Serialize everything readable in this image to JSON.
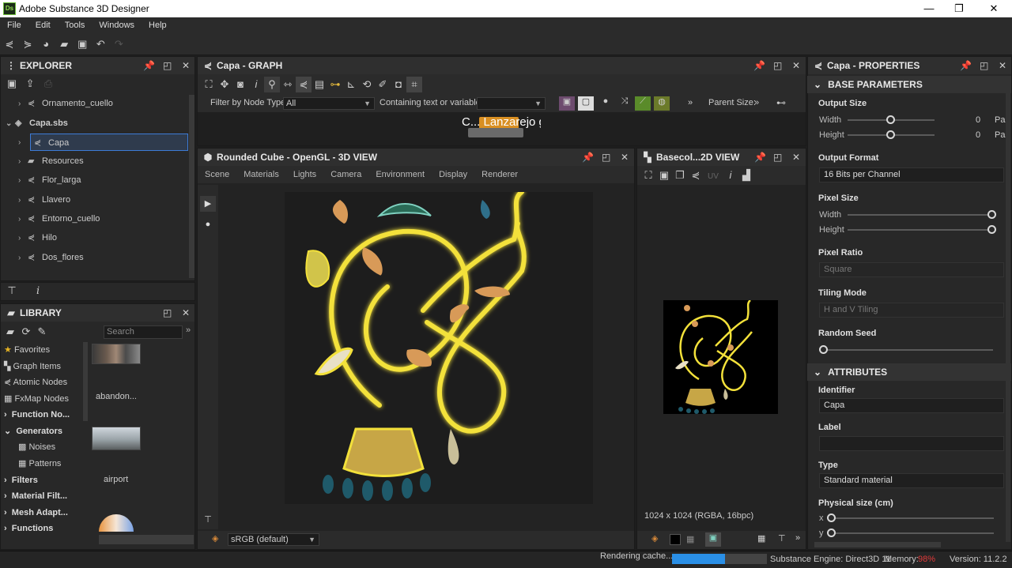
{
  "app": {
    "title": "Adobe Substance 3D Designer",
    "icon_text": "Ds"
  },
  "window_controls": {
    "minimize": "—",
    "maximize": "❐",
    "close": "✕"
  },
  "menu": [
    "File",
    "Edit",
    "Tools",
    "Windows",
    "Help"
  ],
  "explorer": {
    "title": "EXPLORER",
    "items": [
      {
        "label": "Ornamento_cuello",
        "level": 1
      },
      {
        "label": "Capa.sbs",
        "level": 0
      },
      {
        "label": "Capa",
        "level": 1
      },
      {
        "label": "Resources",
        "level": 1
      },
      {
        "label": "Flor_larga",
        "level": 1
      },
      {
        "label": "Llavero",
        "level": 1
      },
      {
        "label": "Entorno_cuello",
        "level": 1
      },
      {
        "label": "Hilo",
        "level": 1
      },
      {
        "label": "Dos_flores",
        "level": 1
      }
    ]
  },
  "library": {
    "title": "LIBRARY",
    "search_placeholder": "Search",
    "categories": [
      {
        "label": "Favorites"
      },
      {
        "label": "Graph Items"
      },
      {
        "label": "Atomic Nodes"
      },
      {
        "label": "FxMap Nodes"
      },
      {
        "label": "Function No..."
      },
      {
        "label": "Generators"
      },
      {
        "label": "Noises"
      },
      {
        "label": "Patterns"
      },
      {
        "label": "Filters"
      },
      {
        "label": "Material Filt..."
      },
      {
        "label": "Mesh Adapt..."
      },
      {
        "label": "Functions"
      }
    ],
    "thumbnails": [
      "abandon...",
      "airport"
    ]
  },
  "graph": {
    "title": "Capa - GRAPH",
    "filter_label": "Filter by Node Type",
    "filter_value": "All",
    "containing_label": "Containing text or variable",
    "parent_size_label": "Parent Size:",
    "overlay_text": "C... Lanzarejo grande"
  },
  "view3d": {
    "title": "Rounded Cube - OpenGL - 3D VIEW",
    "tabs": [
      "Scene",
      "Materials",
      "Lights",
      "Camera",
      "Environment",
      "Display",
      "Renderer"
    ],
    "colorspace": "sRGB (default)"
  },
  "view2d": {
    "title": "Basecol...2D VIEW",
    "uv_label": "UV",
    "info": "1024 x 1024 (RGBA, 16bpc)"
  },
  "properties": {
    "title": "Capa - PROPERTIES",
    "base_parameters": "BASE PARAMETERS",
    "output_size": {
      "label": "Output Size",
      "width_label": "Width",
      "height_label": "Height",
      "width_value": "0",
      "height_value": "0",
      "unit": "Pa"
    },
    "output_format": {
      "label": "Output Format",
      "value": "16 Bits per Channel"
    },
    "pixel_size": {
      "label": "Pixel Size",
      "width_label": "Width",
      "height_label": "Height"
    },
    "pixel_ratio": {
      "label": "Pixel Ratio",
      "value": "Square"
    },
    "tiling_mode": {
      "label": "Tiling Mode",
      "value": "H and V Tiling"
    },
    "random_seed": {
      "label": "Random Seed"
    },
    "attributes": "ATTRIBUTES",
    "identifier": {
      "label": "Identifier",
      "value": "Capa"
    },
    "label": {
      "label": "Label",
      "value": ""
    },
    "type": {
      "label": "Type",
      "value": "Standard material"
    },
    "physical_size": {
      "label": "Physical size (cm)",
      "x_label": "x",
      "y_label": "y"
    }
  },
  "status": {
    "rendering": "Rendering cache...",
    "engine": "Substance Engine: Direct3D 11",
    "memory_label": "Memory:",
    "memory_value": "98%",
    "version": "Version: 11.2.2"
  },
  "colors": {
    "accent": "#3d7bd6",
    "memory_warn": "#e03a3a",
    "glow": "#f3e13a",
    "progress": "#2a8fe6"
  }
}
